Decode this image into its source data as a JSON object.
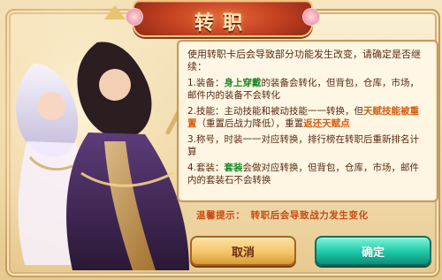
{
  "dialog": {
    "title": "转职",
    "intro": "使用转职卡后会导致部分功能发生改变，请确定是否继续：",
    "items": [
      {
        "prefix": "1.装备：",
        "highlight": "身上穿戴",
        "rest": "的装备会转化，但背包，仓库，市场，邮件内的装备不会转化"
      },
      {
        "prefix": "2.技能：主动技能和被动技能一一转换，但",
        "highlight": "天赋技能被重置",
        "middle": "（重置后战力降低），重置",
        "highlight2": "返还天赋点"
      },
      {
        "text": "3.称号，时装一一对应转换，排行榜在转职后重新排名计算"
      },
      {
        "prefix": "4.套装：",
        "highlight": "套装",
        "rest": "会做对应转换，但背包，仓库，市场，邮件内的套装石不会转换"
      }
    ],
    "tip_label": "温馨提示：",
    "tip_text": "转职后会导致战力发生变化",
    "buttons": {
      "cancel": "取消",
      "confirm": "确定"
    }
  },
  "colors": {
    "highlight_green": "#1a8a2a",
    "highlight_orange": "#d45b10",
    "tip": "#c84a13"
  }
}
